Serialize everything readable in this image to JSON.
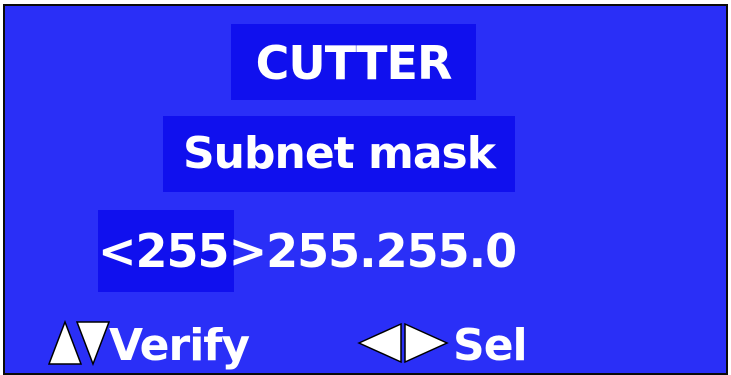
{
  "screen": {
    "title": "CUTTER",
    "parameter_label": "Subnet mask",
    "value": {
      "selected_octet_display": "<255>",
      "remaining_octets": "255.255.0"
    },
    "footer": {
      "verify_label": "Verify",
      "select_label": "Sel"
    }
  },
  "colors": {
    "background": "#2a2ff7",
    "highlight": "#1010ee",
    "text": "#ffffff",
    "frame": "#0a0a0a"
  },
  "icons": {
    "verify": [
      "up-triangle-icon",
      "down-triangle-icon"
    ],
    "select": [
      "left-triangle-icon",
      "right-triangle-icon"
    ]
  }
}
